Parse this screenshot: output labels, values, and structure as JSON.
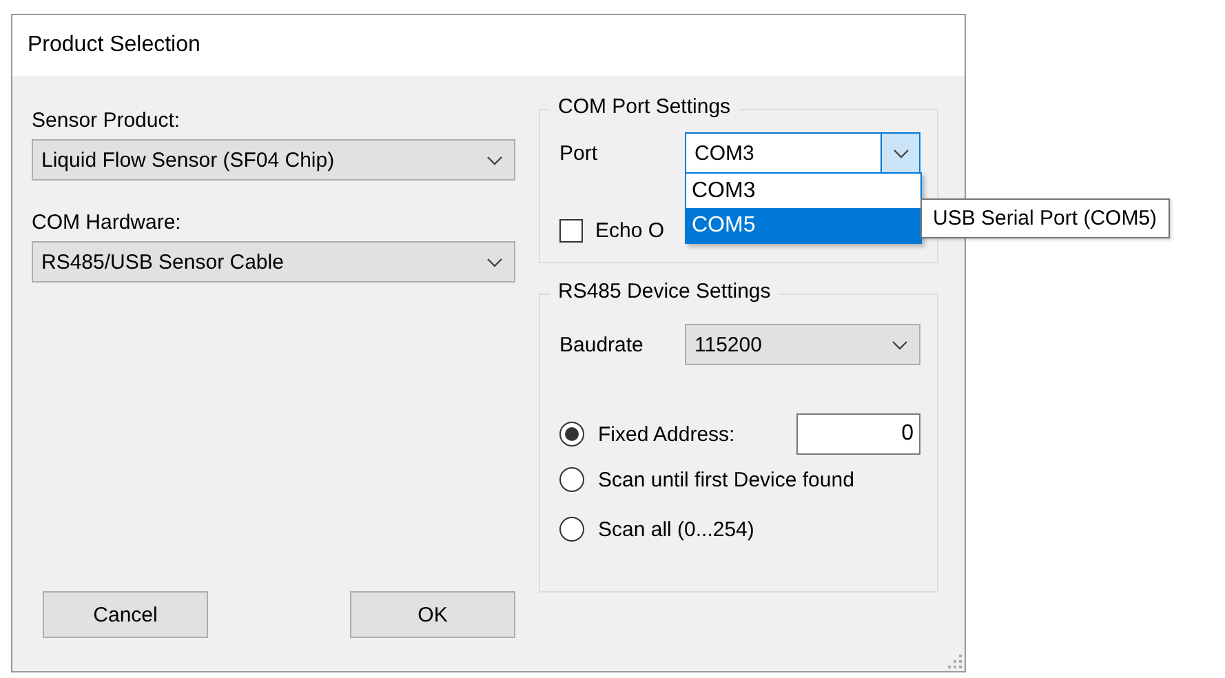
{
  "window": {
    "title": "Product Selection"
  },
  "sensor_product": {
    "label": "Sensor Product:",
    "value": "Liquid Flow Sensor (SF04 Chip)"
  },
  "com_hardware": {
    "label": "COM Hardware:",
    "value": "RS485/USB Sensor Cable"
  },
  "com_port_settings": {
    "title": "COM Port Settings",
    "port": {
      "label": "Port",
      "value": "COM3",
      "expanded": true,
      "options": [
        {
          "label": "COM3",
          "highlighted": false
        },
        {
          "label": "COM5",
          "highlighted": true
        }
      ],
      "tooltip": "USB Serial Port (COM5)"
    },
    "echo": {
      "label": "Echo O",
      "checked": false
    }
  },
  "rs485_device_settings": {
    "title": "RS485 Device Settings",
    "baudrate": {
      "label": "Baudrate",
      "value": "115200"
    },
    "address_modes": [
      {
        "label": "Fixed Address:",
        "selected": true,
        "kind": "field",
        "value": "0"
      },
      {
        "label": "Scan until first Device found",
        "selected": false,
        "kind": "plain"
      },
      {
        "label": "Scan all (0...254)",
        "selected": false,
        "kind": "plain"
      }
    ]
  },
  "buttons": [
    {
      "label": "Cancel"
    },
    {
      "label": "OK"
    }
  ]
}
